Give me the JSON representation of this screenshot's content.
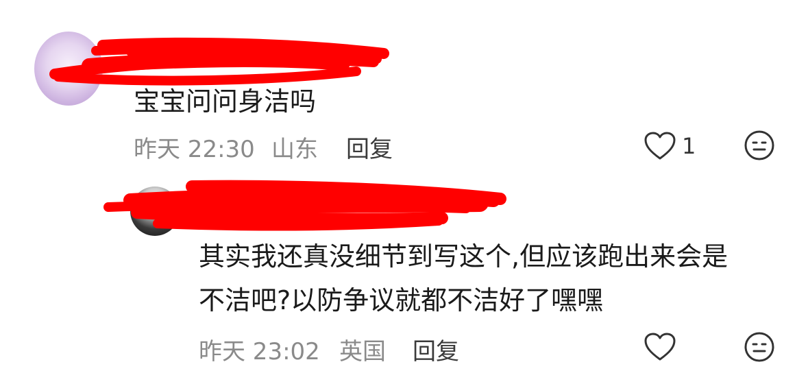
{
  "comment1": {
    "text": "宝宝问问身洁吗",
    "time": "昨天 22:30",
    "location": "山东",
    "reply_label": "回复",
    "like_count": "1"
  },
  "comment2": {
    "text_line1": "其实我还真没细节到写这个,但应该跑出来会是",
    "text_line2": "不洁吧?以防争议就都不洁好了嘿嘿",
    "time": "昨天 23:02",
    "location": "英国",
    "reply_label": "回复"
  },
  "colors": {
    "redaction": "#ff0000",
    "meta_gray": "#8a8a8a"
  },
  "icons": [
    "heart-icon",
    "emoji-icon"
  ]
}
